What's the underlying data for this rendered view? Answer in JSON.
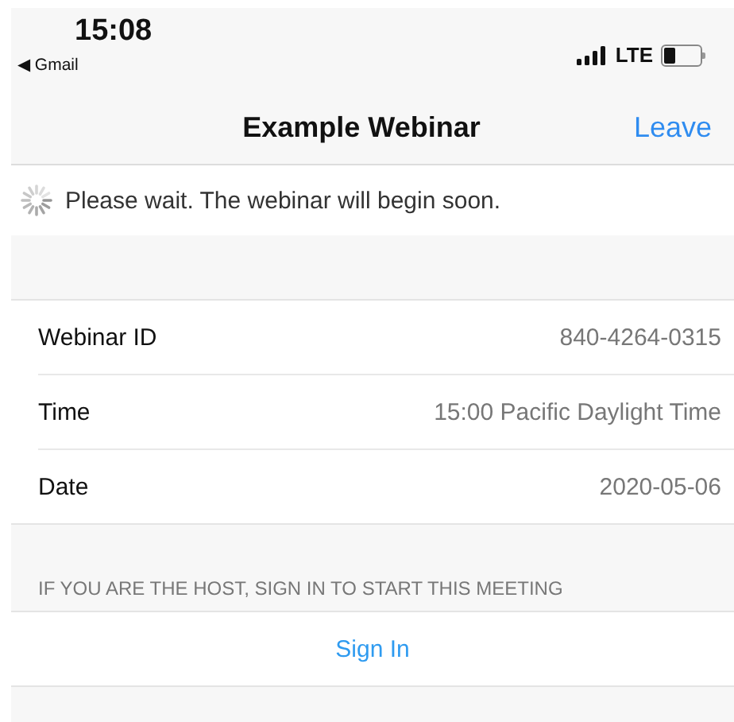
{
  "status_bar": {
    "time": "15:08",
    "back_app": "◀ Gmail",
    "network": "LTE",
    "battery": {
      "level": 0.3
    }
  },
  "nav": {
    "title": "Example Webinar",
    "action": "Leave"
  },
  "notice": {
    "text": "Please wait. The webinar will begin soon."
  },
  "details": [
    {
      "label": "Webinar ID",
      "value": "840-4264-0315"
    },
    {
      "label": "Time",
      "value": "15:00 Pacific Daylight Time"
    },
    {
      "label": "Date",
      "value": "2020-05-06"
    }
  ],
  "host_section": {
    "header": "IF YOU ARE THE HOST, SIGN IN TO START THIS MEETING",
    "button": "Sign In"
  }
}
